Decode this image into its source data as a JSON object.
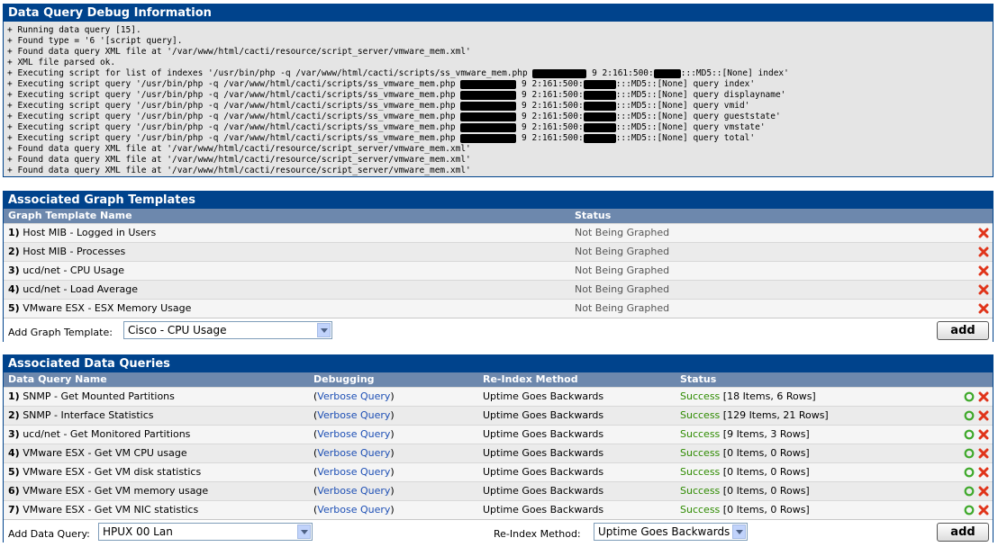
{
  "debug": {
    "title": "Data Query Debug Information",
    "lines": [
      {
        "a": "+ Running data query [15].",
        "r": [],
        "b": ""
      },
      {
        "a": "+ Found type = '6 '[script query].",
        "r": [],
        "b": ""
      },
      {
        "a": "+ Found data query XML file at '/var/www/html/cacti/resource/script_server/vmware_mem.xml'",
        "r": [],
        "b": ""
      },
      {
        "a": "+ XML file parsed ok.",
        "r": [],
        "b": ""
      },
      {
        "a": "+ Executing script for list of indexes '/usr/bin/php -q /var/www/html/cacti/scripts/ss_vmware_mem.php ",
        "r": [
          60
        ],
        "b": " 9 2:161:500:",
        "r2": [
          30
        ],
        "c": ":::MD5::[None] index'"
      },
      {
        "a": "+ Executing script query '/usr/bin/php -q /var/www/html/cacti/scripts/ss_vmware_mem.php ",
        "r": [
          62
        ],
        "b": " 9 2:161:500:",
        "r2": [
          36
        ],
        "c": ":::MD5::[None] query index'"
      },
      {
        "a": "+ Executing script query '/usr/bin/php -q /var/www/html/cacti/scripts/ss_vmware_mem.php ",
        "r": [
          62
        ],
        "b": " 9 2:161:500:",
        "r2": [
          36
        ],
        "c": ":::MD5::[None] query displayname'"
      },
      {
        "a": "+ Executing script query '/usr/bin/php -q /var/www/html/cacti/scripts/ss_vmware_mem.php ",
        "r": [
          62
        ],
        "b": " 9 2:161:500:",
        "r2": [
          36
        ],
        "c": ":::MD5::[None] query vmid'"
      },
      {
        "a": "+ Executing script query '/usr/bin/php -q /var/www/html/cacti/scripts/ss_vmware_mem.php ",
        "r": [
          62
        ],
        "b": " 9 2:161:500:",
        "r2": [
          36
        ],
        "c": ":::MD5::[None] query gueststate'"
      },
      {
        "a": "+ Executing script query '/usr/bin/php -q /var/www/html/cacti/scripts/ss_vmware_mem.php ",
        "r": [
          62
        ],
        "b": " 9 2:161:500:",
        "r2": [
          36
        ],
        "c": ":::MD5::[None] query vmstate'"
      },
      {
        "a": "+ Executing script query '/usr/bin/php -q /var/www/html/cacti/scripts/ss_vmware_mem.php ",
        "r": [
          62
        ],
        "b": " 9 2:161:500:",
        "r2": [
          36
        ],
        "c": ":::MD5::[None] query total'"
      },
      {
        "a": "+ Found data query XML file at '/var/www/html/cacti/resource/script_server/vmware_mem.xml'",
        "r": [],
        "b": ""
      },
      {
        "a": "+ Found data query XML file at '/var/www/html/cacti/resource/script_server/vmware_mem.xml'",
        "r": [],
        "b": ""
      },
      {
        "a": "+ Found data query XML file at '/var/www/html/cacti/resource/script_server/vmware_mem.xml'",
        "r": [],
        "b": ""
      }
    ]
  },
  "graphs": {
    "title": "Associated Graph Templates",
    "col_name": "Graph Template Name",
    "col_status": "Status",
    "rows": [
      {
        "num": "1)",
        "name": "Host MIB - Logged in Users",
        "status": "Not Being Graphed"
      },
      {
        "num": "2)",
        "name": "Host MIB - Processes",
        "status": "Not Being Graphed"
      },
      {
        "num": "3)",
        "name": "ucd/net - CPU Usage",
        "status": "Not Being Graphed"
      },
      {
        "num": "4)",
        "name": "ucd/net - Load Average",
        "status": "Not Being Graphed"
      },
      {
        "num": "5)",
        "name": "VMware ESX - ESX Memory Usage",
        "status": "Not Being Graphed"
      }
    ],
    "add_label": "Add Graph Template:",
    "add_value": "Cisco - CPU Usage",
    "add_button": "add"
  },
  "queries": {
    "title": "Associated Data Queries",
    "col_name": "Data Query Name",
    "col_debug": "Debugging",
    "col_reindex": "Re-Index Method",
    "col_status": "Status",
    "rows": [
      {
        "num": "1)",
        "name": "SNMP - Get Mounted Partitions",
        "debug": "Verbose Query",
        "reindex": "Uptime Goes Backwards",
        "status": "Success",
        "detail": "[18 Items, 6 Rows]"
      },
      {
        "num": "2)",
        "name": "SNMP - Interface Statistics",
        "debug": "Verbose Query",
        "reindex": "Uptime Goes Backwards",
        "status": "Success",
        "detail": "[129 Items, 21 Rows]"
      },
      {
        "num": "3)",
        "name": "ucd/net - Get Monitored Partitions",
        "debug": "Verbose Query",
        "reindex": "Uptime Goes Backwards",
        "status": "Success",
        "detail": "[9 Items, 3 Rows]"
      },
      {
        "num": "4)",
        "name": "VMware ESX - Get VM CPU usage",
        "debug": "Verbose Query",
        "reindex": "Uptime Goes Backwards",
        "status": "Success",
        "detail": "[0 Items, 0 Rows]"
      },
      {
        "num": "5)",
        "name": "VMware ESX - Get VM disk statistics",
        "debug": "Verbose Query",
        "reindex": "Uptime Goes Backwards",
        "status": "Success",
        "detail": "[0 Items, 0 Rows]"
      },
      {
        "num": "6)",
        "name": "VMware ESX - Get VM memory usage",
        "debug": "Verbose Query",
        "reindex": "Uptime Goes Backwards",
        "status": "Success",
        "detail": "[0 Items, 0 Rows]"
      },
      {
        "num": "7)",
        "name": "VMware ESX - Get VM NIC statistics",
        "debug": "Verbose Query",
        "reindex": "Uptime Goes Backwards",
        "status": "Success",
        "detail": "[0 Items, 0 Rows]"
      }
    ],
    "add_label": "Add Data Query:",
    "add_value": "HPUX 00 Lan",
    "reindex_label": "Re-Index Method:",
    "reindex_value": "Uptime Goes Backwards",
    "add_button": "add"
  },
  "colors": {
    "header": "#00438C",
    "colhead": "#6D88AD",
    "success": "#2E8B00",
    "link": "#1D4FB5",
    "delete": "#E0341A",
    "ok": "#3FA92B"
  }
}
